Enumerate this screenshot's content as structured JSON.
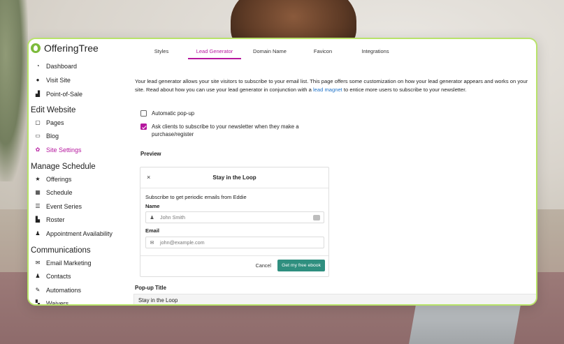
{
  "sidebar": {
    "brand": "OfferingTree",
    "items_top": [
      {
        "label": "Dashboard",
        "icon": "dashboard-icon",
        "glyph": "◔"
      },
      {
        "label": "Visit Site",
        "icon": "globe-icon",
        "glyph": "●"
      },
      {
        "label": "Point-of-Sale",
        "icon": "bag-icon",
        "glyph": "▟"
      }
    ],
    "section_edit": "Edit Website",
    "items_edit": [
      {
        "label": "Pages",
        "icon": "pages-icon",
        "glyph": "▢"
      },
      {
        "label": "Blog",
        "icon": "blog-icon",
        "glyph": "▭"
      },
      {
        "label": "Site Settings",
        "icon": "gear-icon",
        "glyph": "✿"
      }
    ],
    "section_schedule": "Manage Schedule",
    "items_schedule": [
      {
        "label": "Offerings",
        "icon": "star-icon",
        "glyph": "★"
      },
      {
        "label": "Schedule",
        "icon": "calendar-icon",
        "glyph": "▦"
      },
      {
        "label": "Event Series",
        "icon": "list-icon",
        "glyph": "☰"
      },
      {
        "label": "Roster",
        "icon": "roster-icon",
        "glyph": "▙"
      },
      {
        "label": "Appointment Availability",
        "icon": "users-icon",
        "glyph": "♟"
      }
    ],
    "section_comms": "Communications",
    "items_comms": [
      {
        "label": "Email Marketing",
        "icon": "mail-icon",
        "glyph": "✉"
      },
      {
        "label": "Contacts",
        "icon": "contacts-icon",
        "glyph": "♟"
      },
      {
        "label": "Automations",
        "icon": "wand-icon",
        "glyph": "✎"
      },
      {
        "label": "Waivers",
        "icon": "waiver-icon",
        "glyph": "▚"
      }
    ]
  },
  "tabs": [
    "Styles",
    "Lead Generator",
    "Domain Name",
    "Favicon",
    "Integrations"
  ],
  "active_tab": "Lead Generator",
  "main": {
    "desc_part1": "Your lead generator allows your site visitors to subscribe to your email list. This page offers some customization on how your lead generator appears and works on your site. Read about how you can use your lead generator in conjunction with a ",
    "desc_link": "lead magnet",
    "desc_part2": " to entice more users to subscribe to your newsletter.",
    "check_auto_popup": "Automatic pop-up",
    "check_auto_popup_checked": false,
    "check_ask_clients": "Ask clients to subscribe to your newsletter when they make a purchase/register",
    "check_ask_clients_checked": true,
    "preview_label": "Preview",
    "popup_title_label": "Pop-up Title",
    "popup_title_value": "Stay in the Loop"
  },
  "modal": {
    "close": "×",
    "title": "Stay in the Loop",
    "subtitle": "Subscribe to get periodic emails from Eddie",
    "name_label": "Name",
    "name_placeholder": "John Smith",
    "email_label": "Email",
    "email_placeholder": "john@example.com",
    "cancel": "Cancel",
    "submit": "Get my free ebook"
  },
  "colors": {
    "accent": "#b5179e",
    "brand_green": "#7dbb3c",
    "border_green": "#b8e36a",
    "button_teal": "#2f8f7f",
    "link_blue": "#1f73c9"
  }
}
